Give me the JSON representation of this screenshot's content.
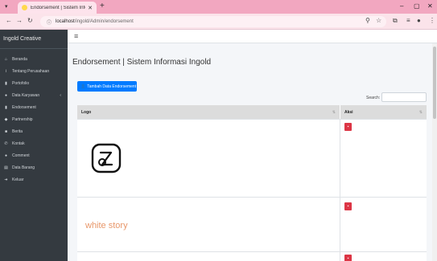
{
  "browser": {
    "tab_title": "Endorsement | Sistem Informa",
    "tab_close": "✕",
    "new_tab": "+",
    "url_host": "localhost",
    "url_path": "/ingold/Admin/endorsement",
    "win_minimize": "–",
    "win_maximize": "▢",
    "win_close": "✕"
  },
  "sidebar": {
    "brand": "Ingold Creative",
    "items": [
      {
        "label": "Beranda",
        "icon": "home-icon",
        "glyph": "⌂"
      },
      {
        "label": "Tentang Perusahaan",
        "icon": "info-icon",
        "glyph": "i"
      },
      {
        "label": "Portofolio",
        "icon": "file-icon",
        "glyph": "▮"
      },
      {
        "label": "Data Karyawan",
        "icon": "users-icon",
        "glyph": "●",
        "arrow": "‹"
      },
      {
        "label": "Endorsement",
        "icon": "document-icon",
        "glyph": "▮"
      },
      {
        "label": "Partnership",
        "icon": "handshake-icon",
        "glyph": "◆"
      },
      {
        "label": "Berita",
        "icon": "news-icon",
        "glyph": "■"
      },
      {
        "label": "Kontak",
        "icon": "phone-icon",
        "glyph": "✆"
      },
      {
        "label": "Comment",
        "icon": "comment-icon",
        "glyph": "●"
      },
      {
        "label": "Data Barang",
        "icon": "table-icon",
        "glyph": "▤"
      },
      {
        "label": "Keluar",
        "icon": "logout-icon",
        "glyph": "➜"
      }
    ]
  },
  "header": {
    "hamburger": "≡",
    "page_title": "Endorsement | Sistem Informasi Ingold"
  },
  "toolbar": {
    "add_label": "Tambah Data Endorsement",
    "search_label": "Search:",
    "search_value": ""
  },
  "table": {
    "columns": [
      {
        "label": "Logo",
        "sort": "⇅"
      },
      {
        "label": "Aksi",
        "sort": "⇅"
      }
    ],
    "rows": [
      {
        "logo": "logo-image"
      },
      {
        "logo_text": "white story"
      },
      {
        "logo": "logo-image"
      }
    ],
    "delete_glyph": "🗑"
  },
  "colors": {
    "sidebar": "#343a40",
    "primary": "#007bff",
    "danger": "#dc3545",
    "browser_tabbar": "#f2a7c0"
  }
}
